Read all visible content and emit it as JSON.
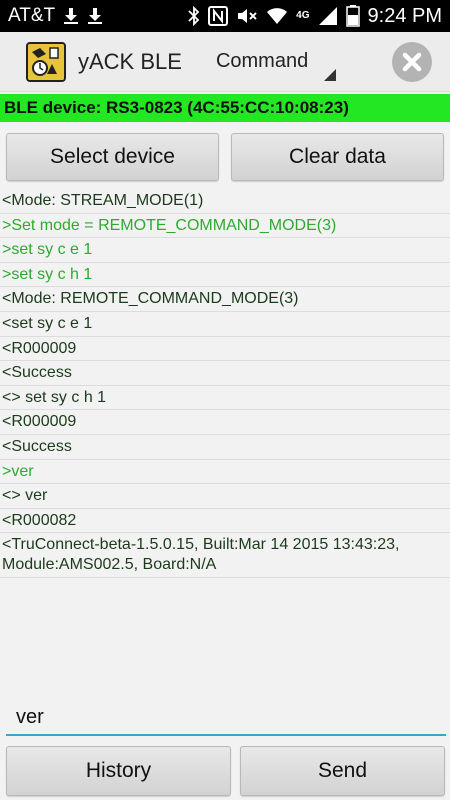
{
  "status_bar": {
    "carrier": "AT&T",
    "time": "9:24 PM",
    "icons": [
      "download-icon",
      "download-icon",
      "bluetooth-icon",
      "nfc-icon",
      "mute-icon",
      "wifi-icon",
      "4g-lte-icon",
      "signal-icon",
      "battery-icon"
    ],
    "network_label": "4G",
    "battery_percent": "40"
  },
  "action_bar": {
    "app_title": "yACK BLE",
    "mode_selected": "Command"
  },
  "ble_banner": {
    "text": "BLE device: RS3-0823 (4C:55:CC:10:08:23)",
    "color": "#22e722"
  },
  "buttons": {
    "select_device": "Select device",
    "clear_data": "Clear data",
    "history": "History",
    "send": "Send"
  },
  "log": [
    {
      "text": "<Mode: STREAM_MODE(1)",
      "dir": "in"
    },
    {
      "text": ">Set mode = REMOTE_COMMAND_MODE(3)",
      "dir": "out"
    },
    {
      "text": ">set sy c e 1",
      "dir": "out"
    },
    {
      "text": ">set sy c h 1",
      "dir": "out"
    },
    {
      "text": "<Mode: REMOTE_COMMAND_MODE(3)",
      "dir": "in"
    },
    {
      "text": "<set sy c e 1",
      "dir": "in"
    },
    {
      "text": "<R000009",
      "dir": "in"
    },
    {
      "text": "<Success",
      "dir": "in"
    },
    {
      "text": "<> set sy c h 1",
      "dir": "in"
    },
    {
      "text": "<R000009",
      "dir": "in"
    },
    {
      "text": "<Success",
      "dir": "in"
    },
    {
      "text": ">ver",
      "dir": "out"
    },
    {
      "text": "<> ver",
      "dir": "in"
    },
    {
      "text": "<R000082",
      "dir": "in"
    },
    {
      "text": "<TruConnect-beta-1.5.0.15, Built:Mar 14 2015 13:43:23, Module:AMS002.5, Board:N/A",
      "dir": "in"
    }
  ],
  "input": {
    "value": "ver"
  },
  "colors": {
    "log_in": "#1c3a1c",
    "log_out": "#2faa2f",
    "input_underline": "#3aa6c9"
  }
}
